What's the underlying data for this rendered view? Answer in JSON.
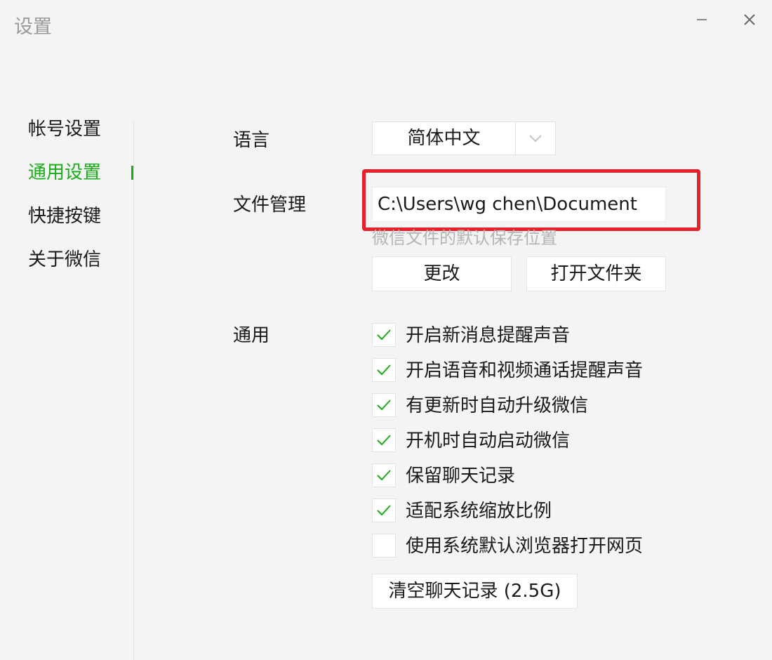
{
  "window": {
    "title": "设置",
    "minimize_icon": "minimize-icon",
    "close_icon": "close-icon"
  },
  "sidebar": {
    "items": [
      {
        "label": "帐号设置",
        "active": false
      },
      {
        "label": "通用设置",
        "active": true
      },
      {
        "label": "快捷按键",
        "active": false
      },
      {
        "label": "关于微信",
        "active": false
      }
    ]
  },
  "settings": {
    "language": {
      "label": "语言",
      "selected": "简体中文"
    },
    "file_management": {
      "label": "文件管理",
      "path": "C:\\Users\\wg   chen\\Document",
      "hint": "微信文件的默认保存位置",
      "change_button": "更改",
      "open_folder_button": "打开文件夹"
    },
    "general": {
      "label": "通用",
      "options": [
        {
          "label": "开启新消息提醒声音",
          "checked": true
        },
        {
          "label": "开启语音和视频通话提醒声音",
          "checked": true
        },
        {
          "label": "有更新时自动升级微信",
          "checked": true
        },
        {
          "label": "开机时自动启动微信",
          "checked": true
        },
        {
          "label": "保留聊天记录",
          "checked": true
        },
        {
          "label": "适配系统缩放比例",
          "checked": true
        },
        {
          "label": "使用系统默认浏览器打开网页",
          "checked": false
        }
      ],
      "clear_history_button": "清空聊天记录 (2.5G)"
    }
  },
  "colors": {
    "accent": "#1aad19",
    "highlight": "#e8202a"
  }
}
